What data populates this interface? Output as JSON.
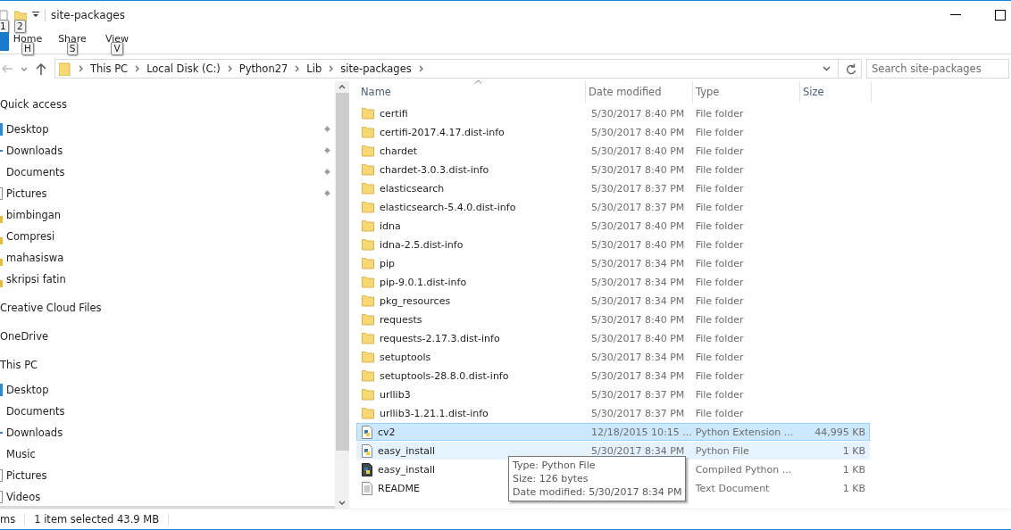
{
  "window": {
    "title": "site-packages",
    "quick_access_keytips": [
      "1",
      "2"
    ]
  },
  "ribbon_tabs": [
    {
      "label": "Home",
      "keytip": "H"
    },
    {
      "label": "Share",
      "keytip": "S"
    },
    {
      "label": "View",
      "keytip": "V"
    }
  ],
  "address": {
    "crumbs": [
      "This PC",
      "Local Disk (C:)",
      "Python27",
      "Lib",
      "site-packages"
    ]
  },
  "search": {
    "placeholder": "Search site-packages"
  },
  "sidebar": {
    "items": [
      {
        "label": "Quick access",
        "kind": "header",
        "pinned": false
      },
      {
        "label": "Desktop",
        "kind": "desktop",
        "pinned": true
      },
      {
        "label": "Downloads",
        "kind": "downloads",
        "pinned": true
      },
      {
        "label": "Documents",
        "kind": "documents",
        "pinned": true
      },
      {
        "label": "Pictures",
        "kind": "pictures",
        "pinned": true
      },
      {
        "label": "bimbingan",
        "kind": "folder",
        "pinned": false
      },
      {
        "label": "Compresi",
        "kind": "folder",
        "pinned": false
      },
      {
        "label": "mahasiswa",
        "kind": "folder",
        "pinned": false
      },
      {
        "label": "skripsi fatin",
        "kind": "folder",
        "pinned": false
      },
      {
        "label": "Creative Cloud Files",
        "kind": "header",
        "pinned": false
      },
      {
        "label": "OneDrive",
        "kind": "header",
        "pinned": false
      },
      {
        "label": "This PC",
        "kind": "header",
        "pinned": false
      },
      {
        "label": "Desktop",
        "kind": "desktop",
        "pinned": false
      },
      {
        "label": "Documents",
        "kind": "documents",
        "pinned": false
      },
      {
        "label": "Downloads",
        "kind": "downloads",
        "pinned": false
      },
      {
        "label": "Music",
        "kind": "documents",
        "pinned": false
      },
      {
        "label": "Pictures",
        "kind": "pictures",
        "pinned": false
      },
      {
        "label": "Videos",
        "kind": "pictures",
        "pinned": false
      }
    ]
  },
  "table": {
    "columns": [
      "Name",
      "Date modified",
      "Type",
      "Size"
    ],
    "rows": [
      {
        "name": "certifi",
        "date": "5/30/2017 8:40 PM",
        "type": "File folder",
        "kind": "folder",
        "selected": false,
        "hovered": false
      },
      {
        "name": "certifi-2017.4.17.dist-info",
        "date": "5/30/2017 8:40 PM",
        "type": "File folder",
        "kind": "folder",
        "selected": false,
        "hovered": false
      },
      {
        "name": "chardet",
        "date": "5/30/2017 8:40 PM",
        "type": "File folder",
        "kind": "folder",
        "selected": false,
        "hovered": false
      },
      {
        "name": "chardet-3.0.3.dist-info",
        "date": "5/30/2017 8:40 PM",
        "type": "File folder",
        "kind": "folder",
        "selected": false,
        "hovered": false
      },
      {
        "name": "elasticsearch",
        "date": "5/30/2017 8:37 PM",
        "type": "File folder",
        "kind": "folder",
        "selected": false,
        "hovered": false
      },
      {
        "name": "elasticsearch-5.4.0.dist-info",
        "date": "5/30/2017 8:37 PM",
        "type": "File folder",
        "kind": "folder",
        "selected": false,
        "hovered": false
      },
      {
        "name": "idna",
        "date": "5/30/2017 8:40 PM",
        "type": "File folder",
        "kind": "folder",
        "selected": false,
        "hovered": false
      },
      {
        "name": "idna-2.5.dist-info",
        "date": "5/30/2017 8:40 PM",
        "type": "File folder",
        "kind": "folder",
        "selected": false,
        "hovered": false
      },
      {
        "name": "pip",
        "date": "5/30/2017 8:34 PM",
        "type": "File folder",
        "kind": "folder",
        "selected": false,
        "hovered": false
      },
      {
        "name": "pip-9.0.1.dist-info",
        "date": "5/30/2017 8:34 PM",
        "type": "File folder",
        "kind": "folder",
        "selected": false,
        "hovered": false
      },
      {
        "name": "pkg_resources",
        "date": "5/30/2017 8:34 PM",
        "type": "File folder",
        "kind": "folder",
        "selected": false,
        "hovered": false
      },
      {
        "name": "requests",
        "date": "5/30/2017 8:40 PM",
        "type": "File folder",
        "kind": "folder",
        "selected": false,
        "hovered": false
      },
      {
        "name": "requests-2.17.3.dist-info",
        "date": "5/30/2017 8:40 PM",
        "type": "File folder",
        "kind": "folder",
        "selected": false,
        "hovered": false
      },
      {
        "name": "setuptools",
        "date": "5/30/2017 8:34 PM",
        "type": "File folder",
        "kind": "folder",
        "selected": false,
        "hovered": false
      },
      {
        "name": "setuptools-28.8.0.dist-info",
        "date": "5/30/2017 8:34 PM",
        "type": "File folder",
        "kind": "folder",
        "selected": false,
        "hovered": false
      },
      {
        "name": "urllib3",
        "date": "5/30/2017 8:37 PM",
        "type": "File folder",
        "kind": "folder",
        "selected": false,
        "hovered": false
      },
      {
        "name": "urllib3-1.21.1.dist-info",
        "date": "5/30/2017 8:37 PM",
        "type": "File folder",
        "kind": "folder",
        "selected": false,
        "hovered": false
      },
      {
        "name": "cv2",
        "date": "12/18/2015 10:15 ...",
        "type": "Python Extension ...",
        "size": "44,995 KB",
        "kind": "python",
        "selected": true,
        "hovered": false
      },
      {
        "name": "easy_install",
        "date": "5/30/2017 8:34 PM",
        "type": "Python File",
        "size": "1 KB",
        "kind": "python",
        "selected": false,
        "hovered": true
      },
      {
        "name": "easy_install",
        "type": "Compiled Python ...",
        "size": "1 KB",
        "kind": "compiled",
        "selected": false,
        "hovered": false
      },
      {
        "name": "README",
        "type": "Text Document",
        "size": "1 KB",
        "kind": "text",
        "selected": false,
        "hovered": false
      }
    ]
  },
  "tooltip": {
    "lines": [
      "Type: Python File",
      "Size: 126 bytes",
      "Date modified: 5/30/2017 8:34 PM"
    ]
  },
  "status_bar": {
    "count": "ms",
    "selection": "1 item selected  43.9 MB"
  }
}
